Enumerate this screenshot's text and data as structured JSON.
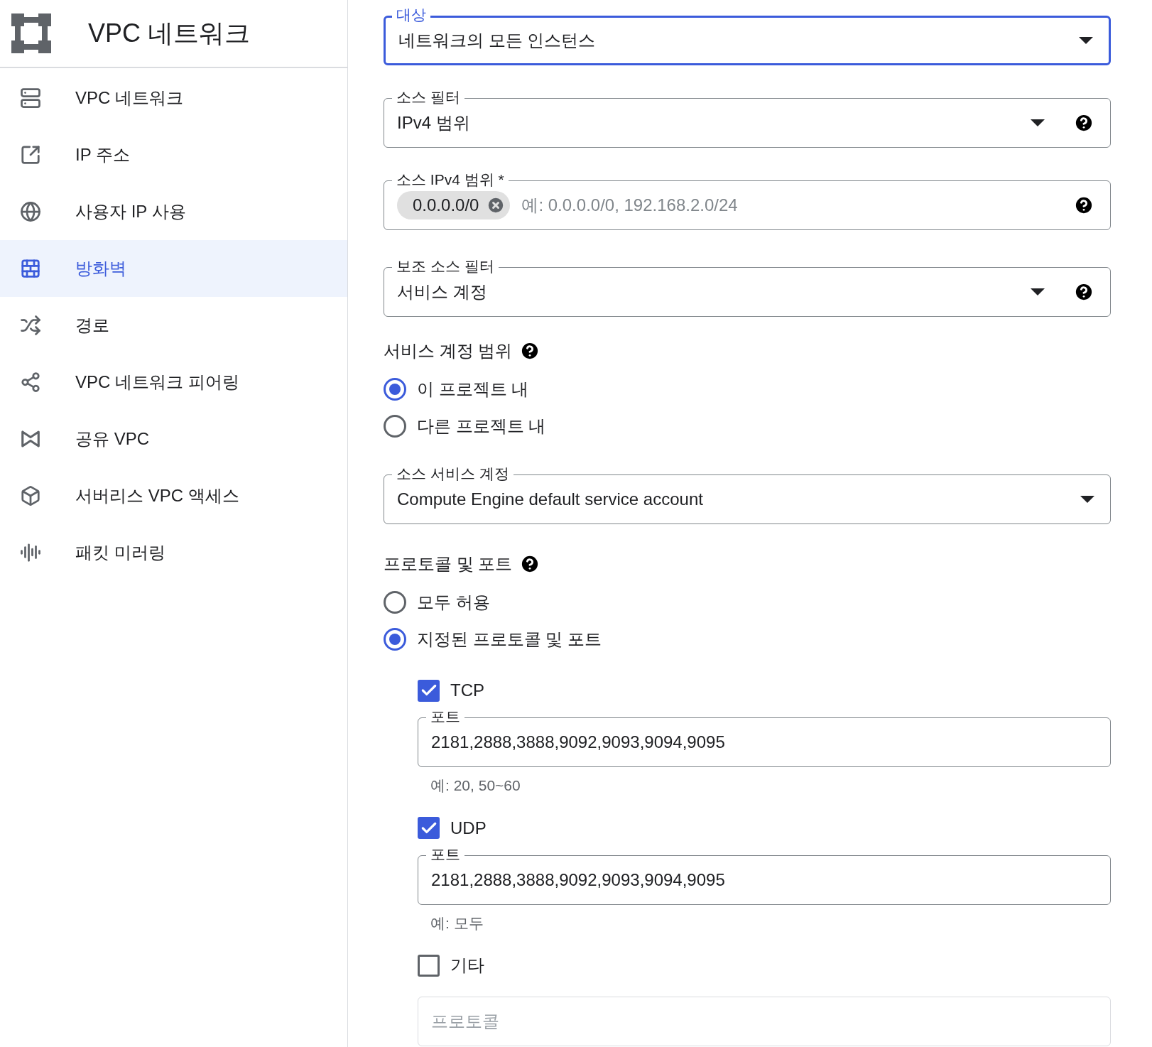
{
  "sidebar": {
    "title": "VPC 네트워크",
    "items": [
      {
        "label": "VPC 네트워크",
        "selected": false
      },
      {
        "label": "IP 주소",
        "selected": false
      },
      {
        "label": "사용자 IP 사용",
        "selected": false
      },
      {
        "label": "방화벽",
        "selected": true
      },
      {
        "label": "경로",
        "selected": false
      },
      {
        "label": "VPC 네트워크 피어링",
        "selected": false
      },
      {
        "label": "공유 VPC",
        "selected": false
      },
      {
        "label": "서버리스 VPC 액세스",
        "selected": false
      },
      {
        "label": "패킷 미러링",
        "selected": false
      }
    ]
  },
  "form": {
    "target": {
      "label": "대상",
      "value": "네트워크의 모든 인스턴스",
      "focused": true,
      "help": false
    },
    "source_filter": {
      "label": "소스 필터",
      "value": "IPv4 범위",
      "focused": false,
      "help": true
    },
    "source_ranges": {
      "label": "소스 IPv4 범위 *",
      "chips": [
        "0.0.0.0/0"
      ],
      "placeholder": "예: 0.0.0.0/0, 192.168.2.0/24",
      "help": true
    },
    "secondary_filter": {
      "label": "보조 소스 필터",
      "value": "서비스 계정",
      "focused": false,
      "help": true
    },
    "service_account_scope": {
      "title": "서비스 계정 범위",
      "options": [
        {
          "label": "이 프로젝트 내",
          "selected": true
        },
        {
          "label": "다른 프로젝트 내",
          "selected": false
        }
      ]
    },
    "source_service_account": {
      "label": "소스 서비스 계정",
      "value": "Compute Engine default service account",
      "focused": false,
      "help": false
    },
    "protocols_ports": {
      "title": "프로토콜 및 포트",
      "options": [
        {
          "label": "모두 허용",
          "selected": false
        },
        {
          "label": "지정된 프로토콜 및 포트",
          "selected": true
        }
      ],
      "protocols": [
        {
          "name": "TCP",
          "checked": true,
          "ports_label": "포트",
          "ports_value": "2181,2888,3888,9092,9093,9094,9095",
          "hint": "예: 20, 50~60"
        },
        {
          "name": "UDP",
          "checked": true,
          "ports_label": "포트",
          "ports_value": "2181,2888,3888,9092,9093,9094,9095",
          "hint": "예: 모두"
        }
      ],
      "other": {
        "name": "기타",
        "checked": false,
        "placeholder": "프로토콜"
      }
    }
  }
}
